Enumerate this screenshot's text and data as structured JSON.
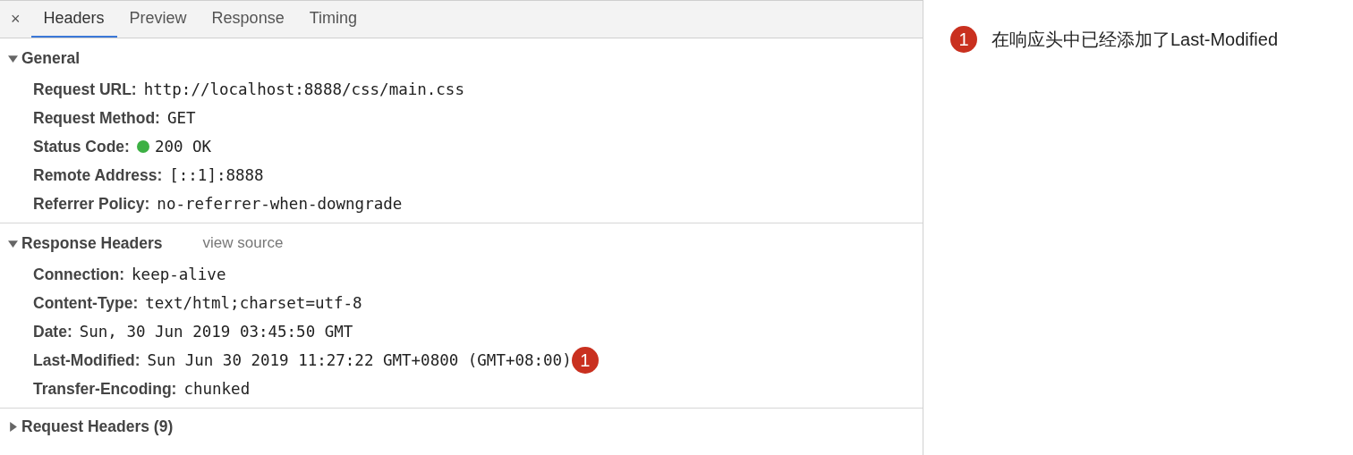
{
  "close_button": "×",
  "tabs": [
    {
      "label": "Headers",
      "selected": true
    },
    {
      "label": "Preview",
      "selected": false
    },
    {
      "label": "Response",
      "selected": false
    },
    {
      "label": "Timing",
      "selected": false
    }
  ],
  "sections": [
    {
      "title": "General",
      "expanded": true,
      "rows": [
        {
          "name": "Request URL:",
          "value": "http://localhost:8888/css/main.css"
        },
        {
          "name": "Request Method:",
          "value": "GET"
        },
        {
          "name": "Status Code:",
          "value": "200 OK",
          "kind": "status",
          "color": "#3cb043"
        },
        {
          "name": "Remote Address:",
          "value": "[::1]:8888"
        },
        {
          "name": "Referrer Policy:",
          "value": "no-referrer-when-downgrade"
        }
      ]
    },
    {
      "title": "Response Headers",
      "expanded": true,
      "link": "view source",
      "rows": [
        {
          "name": "Connection:",
          "value": "keep-alive"
        },
        {
          "name": "Content-Type:",
          "value": "text/html;charset=utf-8"
        },
        {
          "name": "Date:",
          "value": "Sun, 30 Jun 2019 03:45:50 GMT"
        },
        {
          "name": "Last-Modified:",
          "value": "Sun Jun 30 2019 11:27:22 GMT+0800 (GMT+08:00)",
          "marker": "1"
        },
        {
          "name": "Transfer-Encoding:",
          "value": "chunked"
        }
      ]
    },
    {
      "title": "Request Headers (9)",
      "expanded": false
    }
  ],
  "annotation": {
    "marker": "1",
    "text": "在响应头中已经添加了Last-Modified"
  }
}
